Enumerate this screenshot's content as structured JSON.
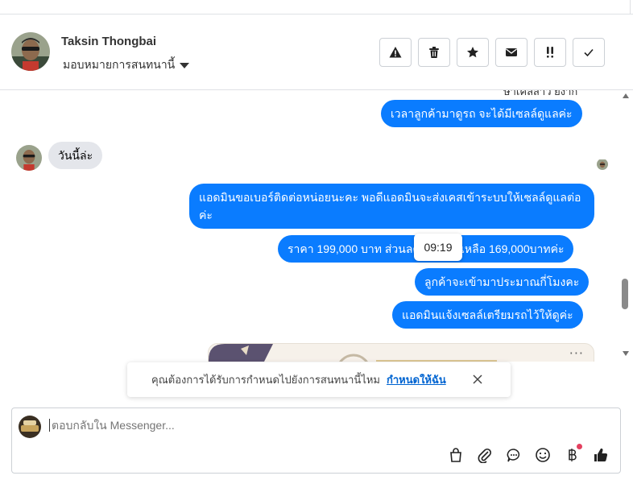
{
  "header": {
    "contact_name": "Taksin Thongbai",
    "assign_label": "มอบหมายการสนทนานี้",
    "actions": [
      {
        "name": "mark-spam-button",
        "icon": "warning-icon"
      },
      {
        "name": "delete-button",
        "icon": "trash-icon"
      },
      {
        "name": "star-button",
        "icon": "star-icon"
      },
      {
        "name": "mark-unread-button",
        "icon": "envelope-icon"
      },
      {
        "name": "follow-up-button",
        "icon": "double-exclamation-icon"
      },
      {
        "name": "mark-done-button",
        "icon": "check-icon"
      }
    ]
  },
  "chat": {
    "cut_off_text": "ษำเคลสาว ยง่าก",
    "messages": [
      {
        "direction": "out",
        "text": "เวลาลูกค้ามาดูรถ จะได้มีเซลล์ดูแลค่ะ"
      },
      {
        "direction": "in",
        "text": "วันนี้ล่ะ"
      },
      {
        "direction": "out",
        "text": "แอดมินขอเบอร์ติดต่อหน่อยนะคะ พอดีแอดมินจะส่งเคสเข้าระบบให้เซลล์ดูแลต่อค่ะ"
      },
      {
        "direction": "out",
        "text": "ราคา 199,000 บาท ส่วนลด 30,000 เหลือ 169,000บาทค่ะ"
      },
      {
        "direction": "out",
        "text": "ลูกค้าจะเข้ามาประมาณกี่โมงคะ"
      },
      {
        "direction": "out",
        "text": "แอดมินแจ้งเซลล์เตรียมรถไว้ให้ดูค่ะ"
      }
    ],
    "tooltip_time": "09:19",
    "preview_more": "···"
  },
  "notice": {
    "text": "คุณต้องการได้รับการกำหนดไปยังการสนทนานี้ไหม",
    "link": "กำหนดให้ฉัน"
  },
  "composer": {
    "placeholder": "ตอบกลับใน Messenger...",
    "tools": [
      "shopping-bag-icon",
      "paperclip-icon",
      "saved-reply-icon",
      "emoji-icon",
      "baht-icon",
      "thumbs-up-icon"
    ]
  },
  "colors": {
    "outgoing": "#0a7cff",
    "incoming": "#e4e6eb",
    "link": "#0064d1"
  }
}
